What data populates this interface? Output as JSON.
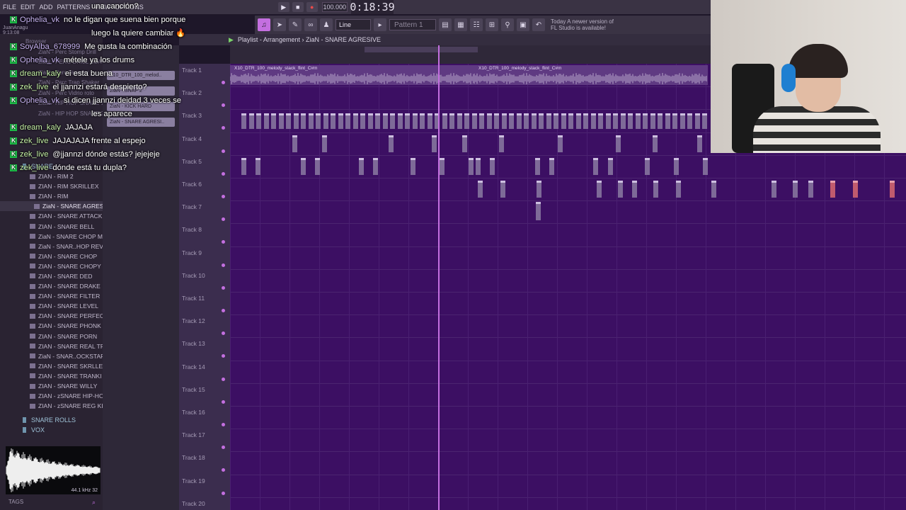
{
  "app": {
    "menu": [
      "FILE",
      "EDIT",
      "ADD",
      "PATTERNS",
      "VIEW",
      "OPTIONS"
    ],
    "tempo": "100.000",
    "time": "0:18:39",
    "user": "JuanAnagu",
    "clock": "9:13:08"
  },
  "toolbar": {
    "snap": "Line",
    "pattern": "Pattern 1",
    "news_title": "Today",
    "news_text": "A newer version of FL Studio is available!"
  },
  "playlist": {
    "breadcrumb": "Playlist - Arrangement › ZiaN - SNARE AGRESIVE",
    "clip_name": "X10_DTR_100_melody_stack_flint_C#m",
    "tracks": [
      "Track 1",
      "Track 2",
      "Track 3",
      "Track 4",
      "Track 5",
      "Track 6",
      "Track 7",
      "Track 8",
      "Track 9",
      "Track 10",
      "Track 11",
      "Track 12",
      "Track 13",
      "Track 14",
      "Track 15",
      "Track 16",
      "Track 17",
      "Track 18",
      "Track 19",
      "Track 20"
    ],
    "patterns": [
      "X10_DTR_100_melod..",
      "ZiaN - SNAP 2",
      "ZiaN - KICK HARD",
      "ZiaN - SNARE AGRESI.."
    ]
  },
  "browser": {
    "header_labels": [
      "Browser",
      "ZiaN - Perc Stomp Drill",
      "ZiaN - PERC DRILL SUAVE",
      "ZiaN - Perc Tenedor",
      "ZiaN - Perc Trap Shaker",
      "ZiaN - Perc Vidrio roto",
      "ZiaN - HIP HOP SNARE 1",
      "ZiaN - HIP HOP SNARE 2"
    ],
    "folder": "SNARE",
    "items": [
      "ZIAN - RIM 2",
      "ZIAN - RIM SKRILLEX",
      "ZIAN - RIM",
      "ZiaN - SNARE AGRESIVE",
      "ZIAN - SNARE ATTACK",
      "ZIAN - SNARE BELL",
      "ZiaN - SNARE CHOP MOD",
      "ZiaN - SNAR..HOP REVERB",
      "ZIAN - SNARE CHOP",
      "ZIAN - SNARE CHOPY",
      "ZIAN - SNARE DED",
      "ZIAN - SNARE DRAKE",
      "ZIAN - SNARE FILTER",
      "ZIAN - SNARE LEVEL",
      "ZIAN - SNARE PERFECT",
      "ZIAN - SNARE PHONK",
      "ZIAN - SNARE PORN",
      "ZIAN - SNARE REAL TRAP",
      "ZiaN - SNAR..OCKSTAR D#",
      "ZIAN - SNARE SKRLLEX",
      "ZIAN - SNARE TRANKI",
      "ZIAN - SNARE WILLY",
      "ZIAN - zSNARE HIP-HOP 1",
      "ZIAN - zSNARE REG KIWYY"
    ],
    "subfolders": [
      "SNARE ROLLS",
      "VOX"
    ],
    "sample_info": "44.1 kHz 32",
    "tags": "TAGS"
  },
  "chat": [
    {
      "user": "",
      "text": "una canción?",
      "badge": false,
      "green": false
    },
    {
      "user": "Ophelia_vk",
      "text": "no le digan que suena bien porque",
      "badge": true,
      "green": false
    },
    {
      "user": "",
      "text": "luego la quiere cambiar 🔥",
      "badge": false,
      "green": false,
      "indent": true
    },
    {
      "user": "SoyAlba_678999",
      "text": "Me gusta la combinación",
      "badge": true,
      "green": false
    },
    {
      "user": "Ophelia_vk",
      "text": "métele ya los drums",
      "badge": true,
      "green": false
    },
    {
      "user": "dream_kaly",
      "text": "ei esta buena",
      "badge": true,
      "green": true
    },
    {
      "user": "zek_live",
      "text": "el jjannzi estará despierto?",
      "badge": true,
      "green": true
    },
    {
      "user": "Ophelia_vk",
      "text": "si dicen jjannzi deidad 3 veces se",
      "badge": true,
      "green": false
    },
    {
      "user": "",
      "text": "les aparece",
      "badge": false,
      "green": false,
      "indent": true
    },
    {
      "user": "dream_kaly",
      "text": "JAJAJA",
      "badge": true,
      "green": true
    },
    {
      "user": "zek_live",
      "text": "JAJAJAJA frente al espejo",
      "badge": true,
      "green": true
    },
    {
      "user": "zek_live",
      "text": "@jjannzi dónde estás? jejejeje",
      "badge": true,
      "green": true
    },
    {
      "user": "zek_live",
      "text": "dónde está tu dupla?",
      "badge": true,
      "green": true
    }
  ],
  "colors": {
    "accent": "#c46fe0",
    "grid_bg": "#3c0f63",
    "chat_user": "#c8b4f2",
    "chat_user_green": "#c6f2a6",
    "badge": "#1ec04a"
  },
  "icons": [
    "play-icon",
    "stop-icon",
    "record-icon",
    "snap-icon",
    "pattern-icon",
    "undo-icon",
    "save-icon",
    "mixer-icon",
    "piano-roll-icon",
    "browser-icon",
    "plugin-icon",
    "help-icon",
    "cpu-icon"
  ]
}
